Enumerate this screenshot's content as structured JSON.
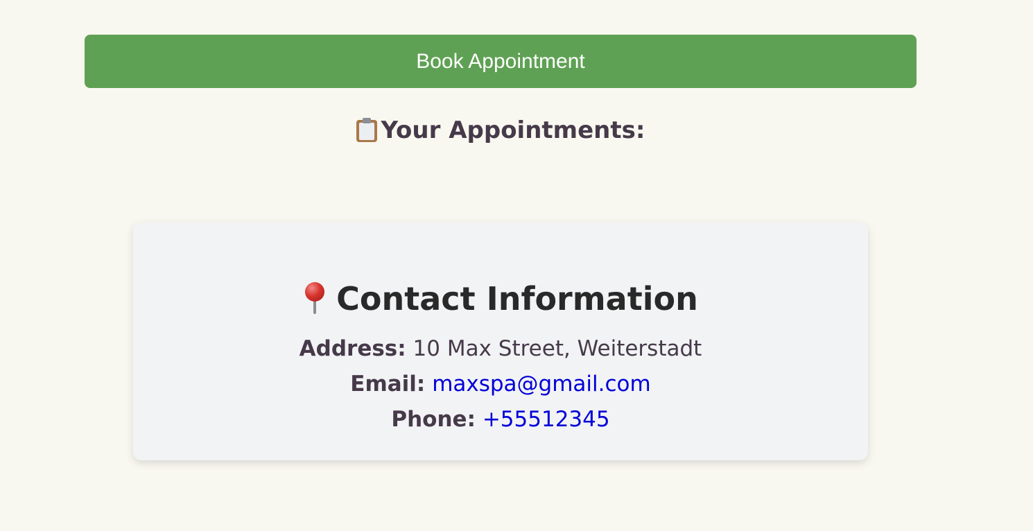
{
  "actions": {
    "book_label": "Book Appointment"
  },
  "appointments": {
    "heading": "Your Appointments:",
    "icon": "clipboard-icon"
  },
  "contact": {
    "title": "Contact Information",
    "icon": "round-pushpin-icon",
    "address_label": "Address:",
    "address_value": "10 Max Street, Weiterstadt",
    "email_label": "Email:",
    "email_value": "maxspa@gmail.com",
    "phone_label": "Phone:",
    "phone_value": "+55512345"
  },
  "colors": {
    "page_background": "#f9f8f0",
    "button_green": "#5fa154",
    "card_background": "#f2f3f4",
    "text_primary": "#463a4a",
    "link_blue": "#0000d8"
  }
}
